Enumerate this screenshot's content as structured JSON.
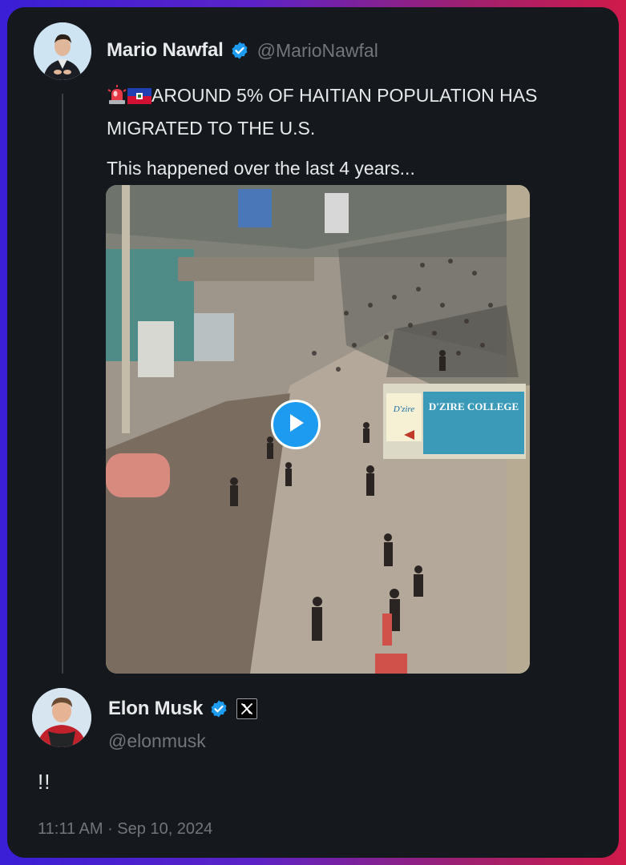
{
  "colors": {
    "accent": "#1d9bf0",
    "card_bg": "#15181d",
    "text": "#e7e9ea",
    "muted": "#71767b"
  },
  "quoted_post": {
    "author": {
      "display_name": "Mario Nawfal",
      "handle": "@MarioNawfal",
      "verified": true
    },
    "emojis": [
      "rotating-light-emoji",
      "haiti-flag-emoji"
    ],
    "text_line1": "AROUND 5% OF HAITIAN POPULATION HAS MIGRATED TO THE U.S.",
    "text_line2": "This happened over the last 4 years...",
    "media": {
      "type": "video",
      "sign_brand": "D'zire",
      "sign_title": "D'ZIRE COLLEGE",
      "play_icon": "play-icon"
    }
  },
  "reply": {
    "author": {
      "display_name": "Elon Musk",
      "handle": "@elonmusk",
      "verified": true,
      "affiliate_badge": "x-logo-icon"
    },
    "text": "!!",
    "timestamp": "11:11 AM · Sep 10, 2024"
  }
}
